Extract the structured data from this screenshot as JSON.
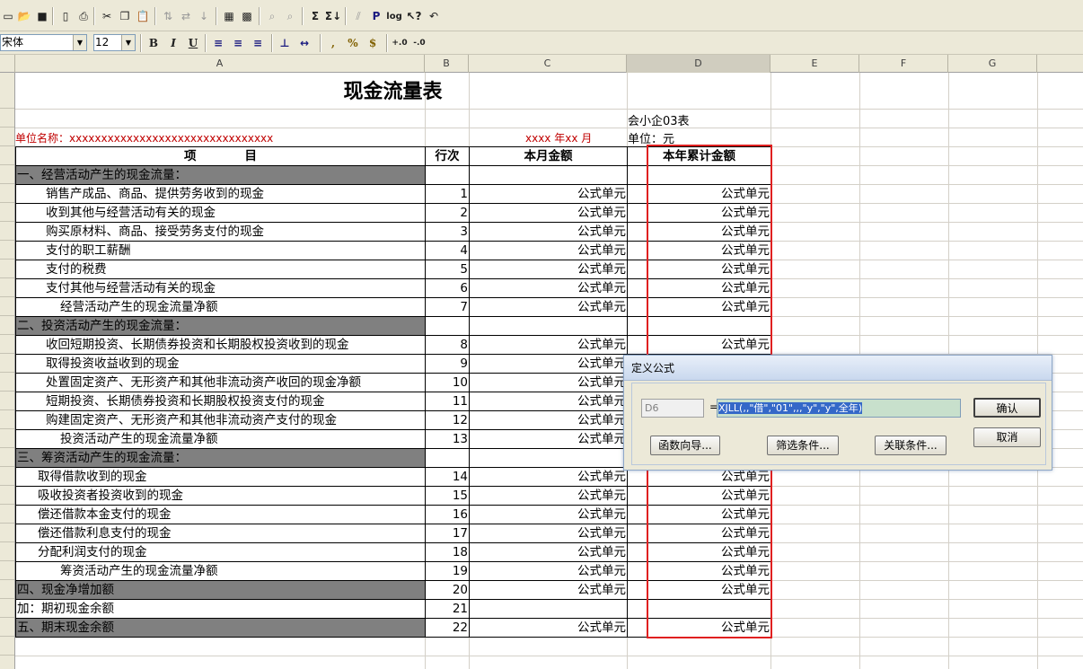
{
  "toolbar": {
    "font_name": "宋体",
    "font_size": "12",
    "bold_label": "B",
    "italic_label": "I",
    "underline_label": "U",
    "percent_label": "%",
    "currency_label": "$",
    "comma_label": ",",
    "sum_label": "Σ",
    "print_label": "P",
    "log_label": "log"
  },
  "columns": [
    "A",
    "B",
    "C",
    "D",
    "E",
    "F",
    "G"
  ],
  "report": {
    "title": "现金流量表",
    "unit_name": "单位名称：xxxxxxxxxxxxxxxxxxxxxxxxxxxxxxxx",
    "year_month": "xxxx 年xx 月",
    "form_no": "会小企03表",
    "unit": "单位：元",
    "headers": [
      "项　　　　目",
      "行次",
      "本月金额",
      "本年累计金额"
    ],
    "rows": [
      {
        "item": "一、经营活动产生的现金流量：",
        "no": "",
        "month": "",
        "year": "",
        "kind": "sec"
      },
      {
        "item": "销售产成品、商品、提供劳务收到的现金",
        "no": "1",
        "month": "公式单元",
        "year": "公式单元",
        "kind": "i1"
      },
      {
        "item": "收到其他与经营活动有关的现金",
        "no": "2",
        "month": "公式单元",
        "year": "公式单元",
        "kind": "i1"
      },
      {
        "item": "购买原材料、商品、接受劳务支付的现金",
        "no": "3",
        "month": "公式单元",
        "year": "公式单元",
        "kind": "i1"
      },
      {
        "item": "支付的职工薪酬",
        "no": "4",
        "month": "公式单元",
        "year": "公式单元",
        "kind": "i1"
      },
      {
        "item": "支付的税费",
        "no": "5",
        "month": "公式单元",
        "year": "公式单元",
        "kind": "i1"
      },
      {
        "item": "支付其他与经营活动有关的现金",
        "no": "6",
        "month": "公式单元",
        "year": "公式单元",
        "kind": "i1"
      },
      {
        "item": "经营活动产生的现金流量净额",
        "no": "7",
        "month": "公式单元",
        "year": "公式单元",
        "kind": "i2"
      },
      {
        "item": "二、投资活动产生的现金流量：",
        "no": "",
        "month": "",
        "year": "",
        "kind": "sec"
      },
      {
        "item": "收回短期投资、长期债券投资和长期股权投资收到的现金",
        "no": "8",
        "month": "公式单元",
        "year": "公式单元",
        "kind": "i1"
      },
      {
        "item": "取得投资收益收到的现金",
        "no": "9",
        "month": "公式单元",
        "year": "",
        "kind": "i1"
      },
      {
        "item": "处置固定资产、无形资产和其他非流动资产收回的现金净额",
        "no": "10",
        "month": "公式单元",
        "year": "",
        "kind": "i1"
      },
      {
        "item": "短期投资、长期债券投资和长期股权投资支付的现金",
        "no": "11",
        "month": "公式单元",
        "year": "",
        "kind": "i1"
      },
      {
        "item": "购建固定资产、无形资产和其他非流动资产支付的现金",
        "no": "12",
        "month": "公式单元",
        "year": "",
        "kind": "i1"
      },
      {
        "item": "投资活动产生的现金流量净额",
        "no": "13",
        "month": "公式单元",
        "year": "",
        "kind": "i2"
      },
      {
        "item": "三、筹资活动产生的现金流量：",
        "no": "",
        "month": "",
        "year": "",
        "kind": "sec"
      },
      {
        "item": "取得借款收到的现金",
        "no": "14",
        "month": "公式单元",
        "year": "公式单元",
        "kind": "i3"
      },
      {
        "item": "吸收投资者投资收到的现金",
        "no": "15",
        "month": "公式单元",
        "year": "公式单元",
        "kind": "i3"
      },
      {
        "item": "偿还借款本金支付的现金",
        "no": "16",
        "month": "公式单元",
        "year": "公式单元",
        "kind": "i3"
      },
      {
        "item": "偿还借款利息支付的现金",
        "no": "17",
        "month": "公式单元",
        "year": "公式单元",
        "kind": "i3"
      },
      {
        "item": "分配利润支付的现金",
        "no": "18",
        "month": "公式单元",
        "year": "公式单元",
        "kind": "i3"
      },
      {
        "item": "筹资活动产生的现金流量净额",
        "no": "19",
        "month": "公式单元",
        "year": "公式单元",
        "kind": "i2"
      },
      {
        "item": "四、现金净增加额",
        "no": "20",
        "month": "公式单元",
        "year": "公式单元",
        "kind": "sec"
      },
      {
        "item": "加：期初现金余额",
        "no": "21",
        "month": "",
        "year": "",
        "kind": "plain"
      },
      {
        "item": "五、期末现金余额",
        "no": "22",
        "month": "公式单元",
        "year": "公式单元",
        "kind": "sec"
      }
    ]
  },
  "dialog": {
    "title": "定义公式",
    "cell_ref": "D6",
    "equals": "=",
    "formula": "XJLL(,,\"借\",\"01\",,,\"y\",\"y\",全年)",
    "ok_label": "确认",
    "cancel_label": "取消",
    "wizard_label": "函数向导...",
    "filter_label": "筛选条件...",
    "link_label": "关联条件..."
  }
}
